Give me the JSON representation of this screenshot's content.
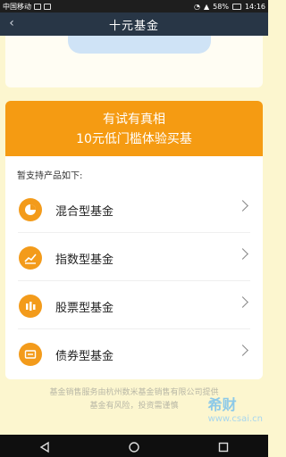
{
  "status_bar": {
    "carrier": "中国移动",
    "battery": "58%",
    "time": "14:16"
  },
  "header": {
    "title": "十元基金"
  },
  "promo": {
    "line1": "有试有真相",
    "line2": "10元低门槛体验买基"
  },
  "support": {
    "label": "暂支持产品如下:"
  },
  "fund_types": [
    {
      "label": "混合型基金",
      "icon": "pie-chart-icon"
    },
    {
      "label": "指数型基金",
      "icon": "trend-line-icon"
    },
    {
      "label": "股票型基金",
      "icon": "bars-icon"
    },
    {
      "label": "债券型基金",
      "icon": "ticket-icon"
    }
  ],
  "footer": {
    "line1": "基金销售服务由杭州数米基金销售有限公司提供",
    "line2": "基金有风险，投资需谨慎"
  },
  "watermark": {
    "brand": "希财",
    "site": "www.csai.cn"
  },
  "colors": {
    "accent": "#f59b12",
    "nav_bg": "#283646",
    "page_bg": "#fcf6cf"
  }
}
